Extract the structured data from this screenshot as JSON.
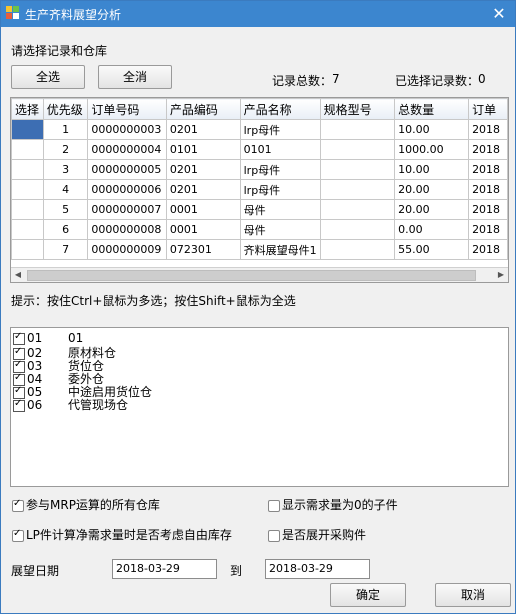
{
  "window": {
    "title": "生产齐料展望分析",
    "close_glyph": "✕"
  },
  "section_label": "请选择记录和仓库",
  "buttons": {
    "select_all": "全选",
    "clear_all": "全消",
    "ok": "确定",
    "cancel": "取消"
  },
  "summary": {
    "total_label": "记录总数：",
    "total_value": "7",
    "selected_label": "已选择记录数：",
    "selected_value": "0"
  },
  "grid": {
    "columns": [
      "选择",
      "优先级",
      "订单号码",
      "产品编码",
      "产品名称",
      "规格型号",
      "总数量",
      "订单"
    ],
    "rows": [
      {
        "priority": "1",
        "order_no": "0000000003",
        "product_code": "0201",
        "product_name": "lrp母件",
        "spec": "",
        "qty": "10.00",
        "date": "2018"
      },
      {
        "priority": "2",
        "order_no": "0000000004",
        "product_code": "0101",
        "product_name": "0101",
        "spec": "",
        "qty": "1000.00",
        "date": "2018"
      },
      {
        "priority": "3",
        "order_no": "0000000005",
        "product_code": "0201",
        "product_name": "lrp母件",
        "spec": "",
        "qty": "10.00",
        "date": "2018"
      },
      {
        "priority": "4",
        "order_no": "0000000006",
        "product_code": "0201",
        "product_name": "lrp母件",
        "spec": "",
        "qty": "20.00",
        "date": "2018"
      },
      {
        "priority": "5",
        "order_no": "0000000007",
        "product_code": "0001",
        "product_name": "母件",
        "spec": "",
        "qty": "20.00",
        "date": "2018"
      },
      {
        "priority": "6",
        "order_no": "0000000008",
        "product_code": "0001",
        "product_name": "母件",
        "spec": "",
        "qty": "0.00",
        "date": "2018"
      },
      {
        "priority": "7",
        "order_no": "0000000009",
        "product_code": "072301",
        "product_name": "齐料展望母件1",
        "spec": "",
        "qty": "55.00",
        "date": "2018"
      }
    ]
  },
  "hint": "提示：按住Ctrl+鼠标为多选；按住Shift+鼠标为全选",
  "warehouses": [
    {
      "code": "01",
      "name": "01",
      "checked": true
    },
    {
      "code": "02",
      "name": "原材料仓",
      "checked": true
    },
    {
      "code": "03",
      "name": "货位仓",
      "checked": true
    },
    {
      "code": "04",
      "name": "委外仓",
      "checked": true
    },
    {
      "code": "05",
      "name": "中途启用货位仓",
      "checked": true
    },
    {
      "code": "06",
      "name": "代管现场仓",
      "checked": true
    }
  ],
  "options": {
    "all_mrp_warehouses": {
      "label": "参与MRP运算的所有仓库",
      "checked": true
    },
    "show_zero_demand": {
      "label": "显示需求量为0的子件",
      "checked": false
    },
    "lp_consider_free_stock": {
      "label": "LP件计算净需求量时是否考虑自由库存",
      "checked": true
    },
    "expand_purchase": {
      "label": "是否展开采购件",
      "checked": false
    }
  },
  "date_range": {
    "label": "展望日期",
    "from": "2018-03-29",
    "to_label": "到",
    "to": "2018-03-29"
  }
}
